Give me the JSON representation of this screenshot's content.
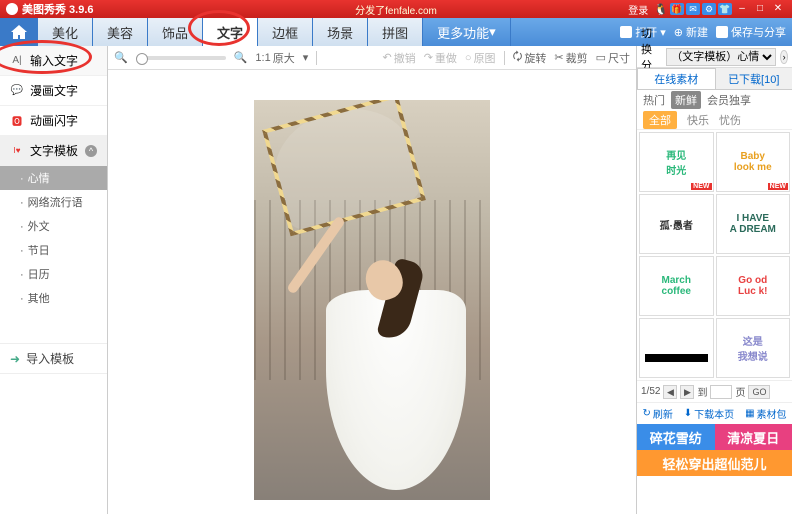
{
  "titlebar": {
    "app_name": "美图秀秀 3.9.6",
    "url": "分发了fenfale.com",
    "login": "登录"
  },
  "menubar": {
    "tabs": [
      "美化",
      "美容",
      "饰品",
      "文字",
      "边框",
      "场景",
      "拼图",
      "更多功能"
    ],
    "active_index": 3,
    "open": "打开",
    "new": "新建",
    "save": "保存与分享"
  },
  "left_panel": {
    "items": [
      {
        "icon": "A|",
        "label": "输入文字"
      },
      {
        "icon": "💬",
        "label": "漫画文字"
      },
      {
        "icon": "🅾",
        "label": "动画闪字"
      },
      {
        "icon": "I♥",
        "label": "文字模板"
      }
    ],
    "categories": [
      "心情",
      "网络流行语",
      "外文",
      "节日",
      "日历",
      "其他"
    ],
    "active_category_index": 0,
    "import": "导入模板"
  },
  "canvas_toolbar": {
    "zoom_fit": "1:1",
    "zoom_label": "原大",
    "undo": "撤销",
    "redo": "重做",
    "restore": "原图",
    "rotate": "旋转",
    "crop": "裁剪",
    "size": "尺寸"
  },
  "right_panel": {
    "switch_label": "切换分类",
    "category_select": "（文字模板）心情",
    "source_tabs": [
      "在线素材",
      "已下载[10]"
    ],
    "active_source": 0,
    "filter_tabs": [
      "热门",
      "新鲜",
      "会员独享"
    ],
    "active_filter": 1,
    "filter2": [
      "全部",
      "快乐",
      "忧伤"
    ],
    "active_filter2": 0,
    "templates": [
      {
        "text": "再见\n时光",
        "color": "#2ab87a",
        "new": true
      },
      {
        "text": "Baby\nlook me",
        "color": "#e8a020",
        "new": true
      },
      {
        "text": "孤·愚者",
        "color": "#333"
      },
      {
        "text": "I HAVE\nA DREAM",
        "color": "#2a6a5a"
      },
      {
        "text": "March\ncoffee",
        "color": "#2ab87a"
      },
      {
        "text": "Go od\nLuc k!",
        "color": "#e84040"
      },
      {
        "text": "",
        "blackbar": true
      },
      {
        "text": "这是\n我想说",
        "color": "#88c"
      }
    ],
    "page_current": "1/52",
    "page_to": "到",
    "page_unit": "页",
    "go": "GO",
    "refresh": "刷新",
    "download_page": "下载本页",
    "material_pack": "素材包",
    "ads": [
      {
        "text": "碎花雪纺",
        "bg": "#3a8de8"
      },
      {
        "text": "清凉夏日",
        "bg": "#e84080"
      },
      {
        "text": "轻松穿出超仙范儿",
        "bg": "#ff9830",
        "full": true
      }
    ]
  }
}
